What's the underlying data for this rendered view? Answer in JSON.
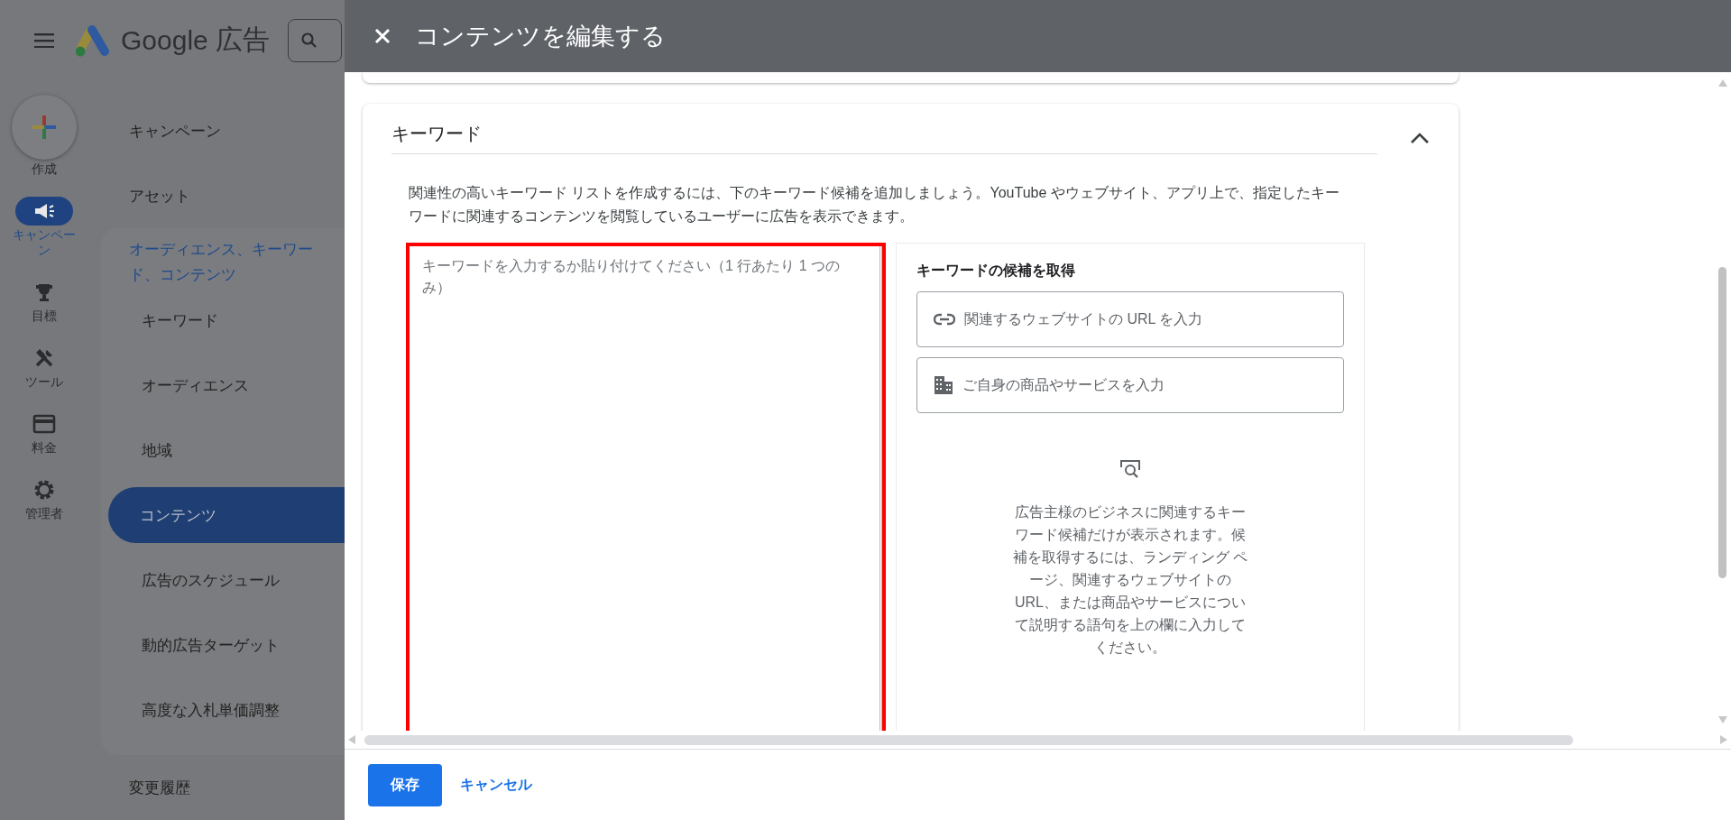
{
  "app": {
    "brand_name": "Google",
    "brand_suffix": "広告"
  },
  "rail": [
    {
      "label": "作成",
      "kind": "create",
      "selected": false
    },
    {
      "label": "キャンペーン",
      "kind": "campaign",
      "selected": true
    },
    {
      "label": "目標",
      "kind": "goal",
      "selected": false
    },
    {
      "label": "ツール",
      "kind": "tools",
      "selected": false
    },
    {
      "label": "料金",
      "kind": "billing",
      "selected": false
    },
    {
      "label": "管理者",
      "kind": "admin",
      "selected": false
    }
  ],
  "nav": [
    {
      "label": "キャンペーン",
      "selected": false
    },
    {
      "label": "アセット",
      "selected": false
    },
    {
      "label": "オーディエンス、キーワード、コンテンツ",
      "selected": false,
      "expanded": true,
      "children": [
        {
          "label": "キーワード",
          "selected": false
        },
        {
          "label": "オーディエンス",
          "selected": false
        },
        {
          "label": "地域",
          "selected": false
        },
        {
          "label": "コンテンツ",
          "selected": true
        },
        {
          "label": "広告のスケジュール",
          "selected": false
        },
        {
          "label": "動的広告ターゲット",
          "selected": false
        },
        {
          "label": "高度な入札単価調整",
          "selected": false
        }
      ]
    },
    {
      "label": "変更履歴",
      "selected": false
    }
  ],
  "panel": {
    "title": "コンテンツを編集する",
    "section": {
      "title": "キーワード",
      "expanded": true,
      "description": "関連性の高いキーワード リストを作成するには、下のキーワード候補を追加しましょう。YouTube やウェブサイト、アプリ上で、指定したキーワードに関連するコンテンツを閲覧しているユーザーに広告を表示できます。",
      "keyword_input": {
        "placeholder": "キーワードを入力するか貼り付けてください（1 行あたり 1 つのみ）",
        "highlighted": true
      },
      "ideas": {
        "title": "キーワードの候補を取得",
        "options": [
          {
            "label": "関連するウェブサイトの URL を入力",
            "kind": "url"
          },
          {
            "label": "ご自身の商品やサービスを入力",
            "kind": "product"
          }
        ],
        "message": "広告主様のビジネスに関連するキーワード候補だけが表示されます。候補を取得するには、ランディング ページ、関連するウェブサイトの URL、または商品やサービスについて説明する語句を上の欄に入力してください。"
      }
    },
    "buttons": [
      {
        "label": "保存",
        "kind": "primary"
      },
      {
        "label": "キャンセル",
        "kind": "text"
      }
    ]
  }
}
